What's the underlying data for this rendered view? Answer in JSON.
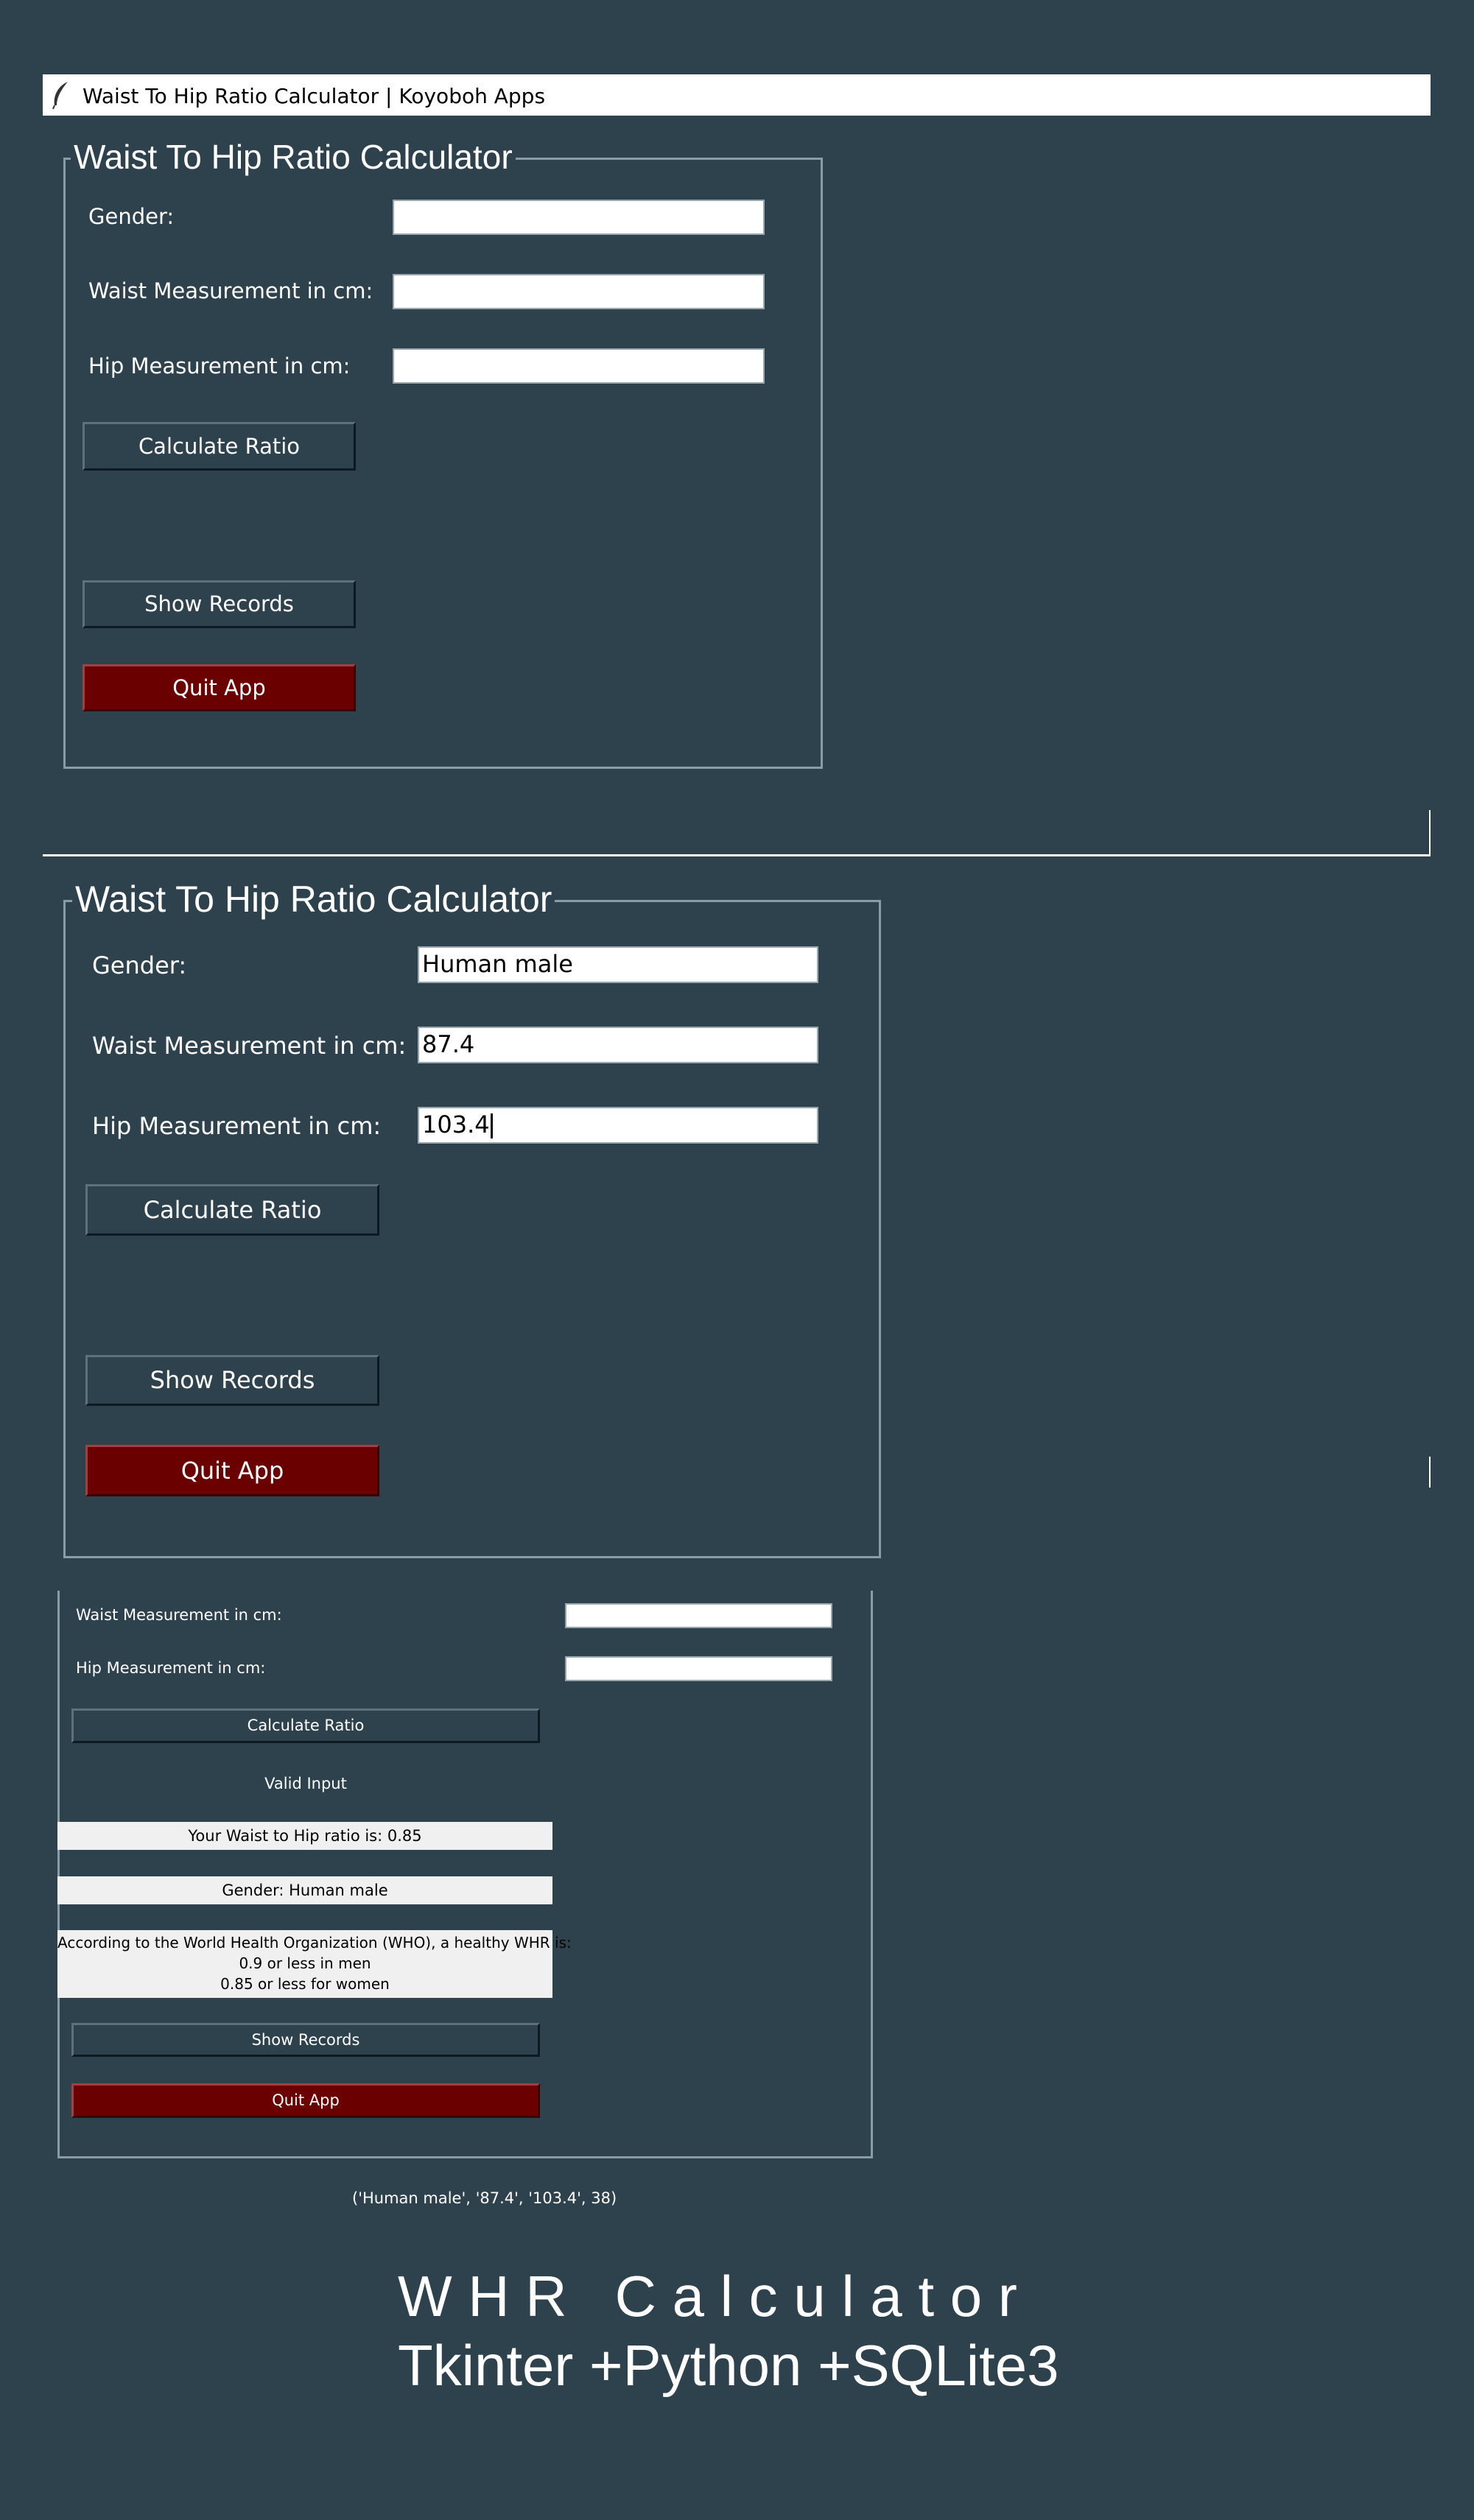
{
  "window": {
    "title": "Waist To Hip Ratio Calculator | Koyoboh Apps",
    "icon": "feather-icon"
  },
  "panel1": {
    "legend": "Waist To Hip Ratio Calculator",
    "gender_label": "Gender:",
    "gender_value": "",
    "waist_label": "Waist Measurement in cm:",
    "waist_value": "",
    "hip_label": "Hip Measurement in cm:",
    "hip_value": "",
    "calculate_button": "Calculate Ratio",
    "show_records_button": "Show Records",
    "quit_button": "Quit App"
  },
  "panel2": {
    "legend": "Waist To Hip Ratio Calculator",
    "gender_label": "Gender:",
    "gender_value": "Human male",
    "waist_label": "Waist Measurement in cm:",
    "waist_value": "87.4",
    "hip_label": "Hip Measurement in cm:",
    "hip_value": "103.4",
    "calculate_button": "Calculate Ratio",
    "show_records_button": "Show Records",
    "quit_button": "Quit App"
  },
  "panel3": {
    "waist_label": "Waist Measurement in cm:",
    "waist_value": "",
    "hip_label": "Hip Measurement in cm:",
    "hip_value": "",
    "calculate_button": "Calculate Ratio",
    "status": "Valid Input",
    "ratio_result": "Your Waist to Hip ratio is: 0.85",
    "gender_result": "Gender: Human male",
    "who_line1": "According to the World Health Organization (WHO), a healthy WHR is:",
    "who_line2": "0.9 or less in men",
    "who_line3": "0.85 or less for women",
    "show_records_button": "Show Records",
    "quit_button": "Quit App"
  },
  "record_output": "('Human male', '87.4', '103.4', 38)",
  "caption": {
    "line1": "W H R   C a l c u l a t o r",
    "line2": "Tkinter +Python +SQLite3"
  },
  "colors": {
    "background": "#2e424e",
    "quit_button": "#6b0000",
    "entry": "#ffffff",
    "info_box": "#f0f0f0"
  }
}
